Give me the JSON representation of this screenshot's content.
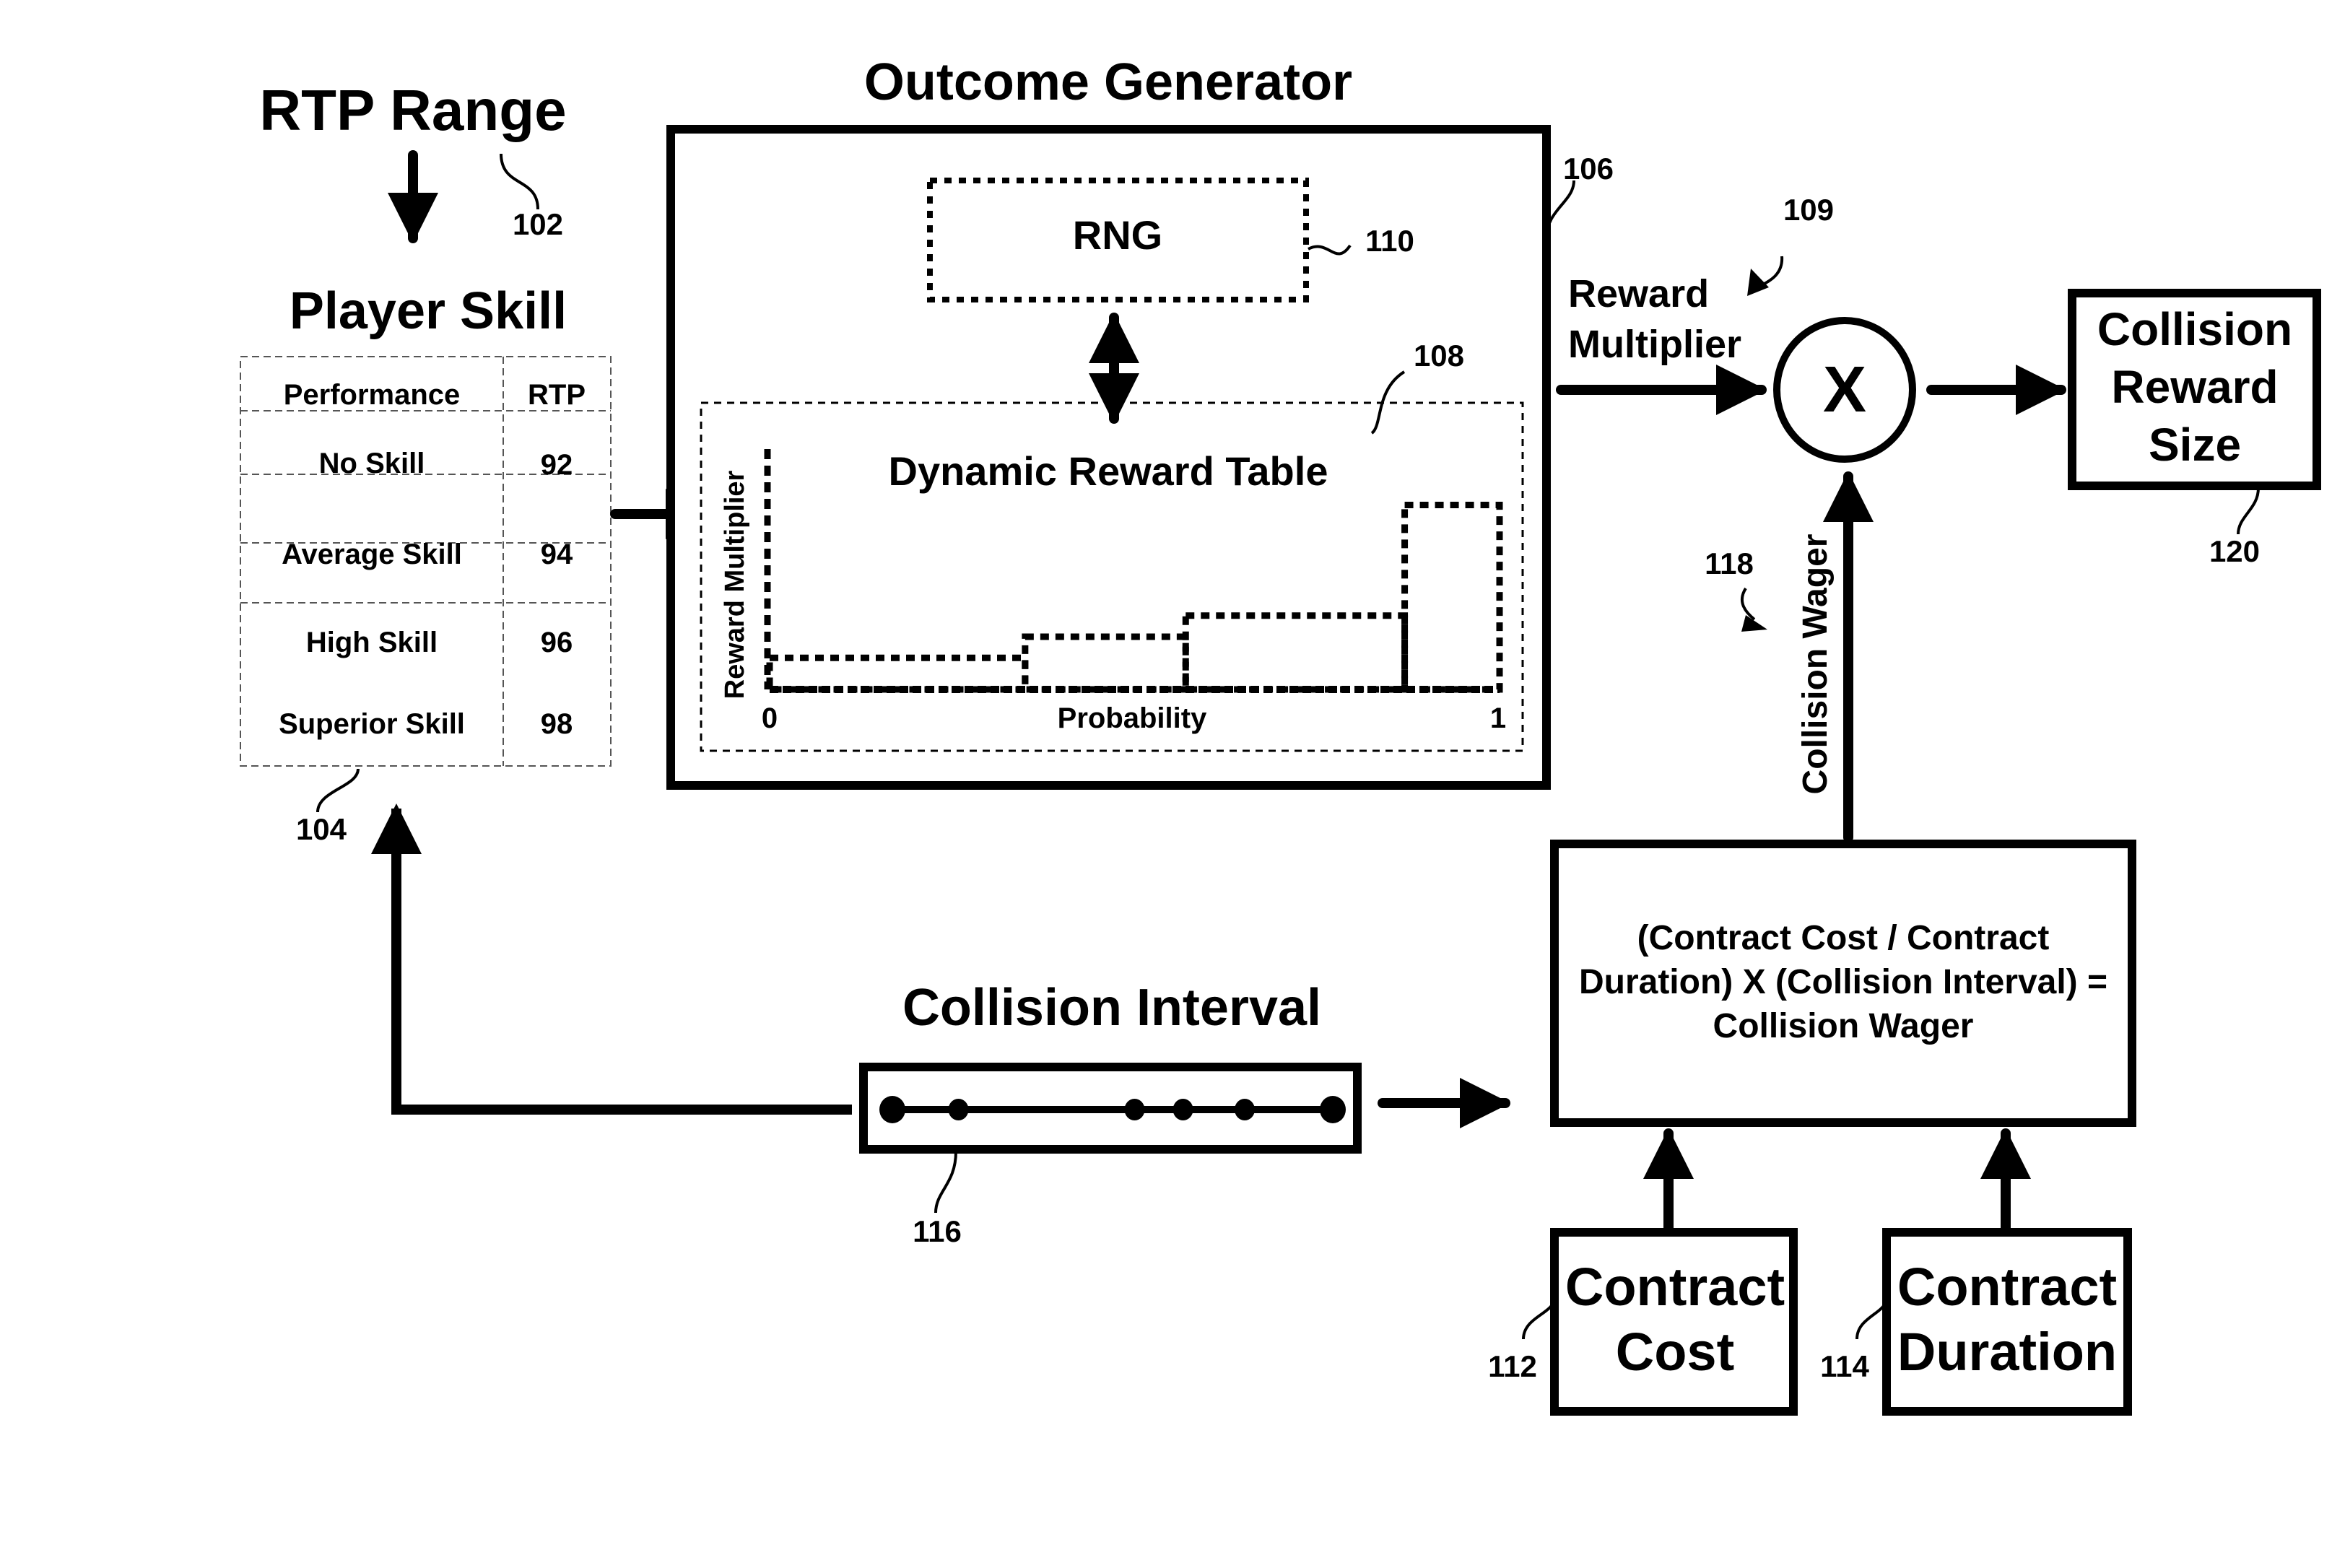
{
  "rtp_range": {
    "title": "RTP Range",
    "ref": "102"
  },
  "player_skill": {
    "title": "Player Skill",
    "ref": "104",
    "table": {
      "headers": [
        "Performance",
        "RTP"
      ],
      "rows": [
        {
          "performance": "No Skill",
          "rtp": "92"
        },
        {
          "performance": "Average Skill",
          "rtp": "94"
        },
        {
          "performance": "High Skill",
          "rtp": "96"
        },
        {
          "performance": "Superior Skill",
          "rtp": "98"
        }
      ]
    }
  },
  "outcome_generator": {
    "title": "Outcome Generator",
    "ref": "106",
    "rng": {
      "label": "RNG",
      "ref": "110"
    },
    "dynamic_reward_table": {
      "ref": "108"
    }
  },
  "multiplier_node": {
    "symbol": "X",
    "ref": "109",
    "input_label_line1": "Reward",
    "input_label_line2": "Multiplier"
  },
  "collision_reward_size": {
    "line1": "Collision",
    "line2": "Reward",
    "line3": "Size",
    "ref": "120"
  },
  "collision_wager": {
    "label": "Collision Wager",
    "ref": "118"
  },
  "formula_box": {
    "line1": "(Contract Cost / Contract",
    "line2": "Duration) X (Collision Interval) =",
    "line3": "Collision Wager"
  },
  "contract_cost": {
    "line1": "Contract",
    "line2": "Cost",
    "ref": "112"
  },
  "contract_duration": {
    "line1": "Contract",
    "line2": "Duration",
    "ref": "114"
  },
  "collision_interval": {
    "title": "Collision Interval",
    "ref": "116",
    "event_positions": [
      0.0,
      0.15,
      0.55,
      0.66,
      0.8,
      0.91
    ]
  },
  "chart_data": {
    "type": "bar",
    "title": "Dynamic Reward Table",
    "xlabel": "Probability",
    "ylabel": "Reward Multiplier",
    "x_tick_labels": [
      "0",
      "1"
    ],
    "xlim": [
      0,
      1
    ],
    "ylim": [
      0,
      1
    ],
    "grid": false,
    "legend": "none",
    "bars": [
      {
        "x_start": 0.0,
        "x_end": 0.35,
        "value": 0.12
      },
      {
        "x_start": 0.35,
        "x_end": 0.57,
        "value": 0.2
      },
      {
        "x_start": 0.57,
        "x_end": 0.87,
        "value": 0.28
      },
      {
        "x_start": 0.87,
        "x_end": 1.0,
        "value": 0.7
      }
    ]
  }
}
